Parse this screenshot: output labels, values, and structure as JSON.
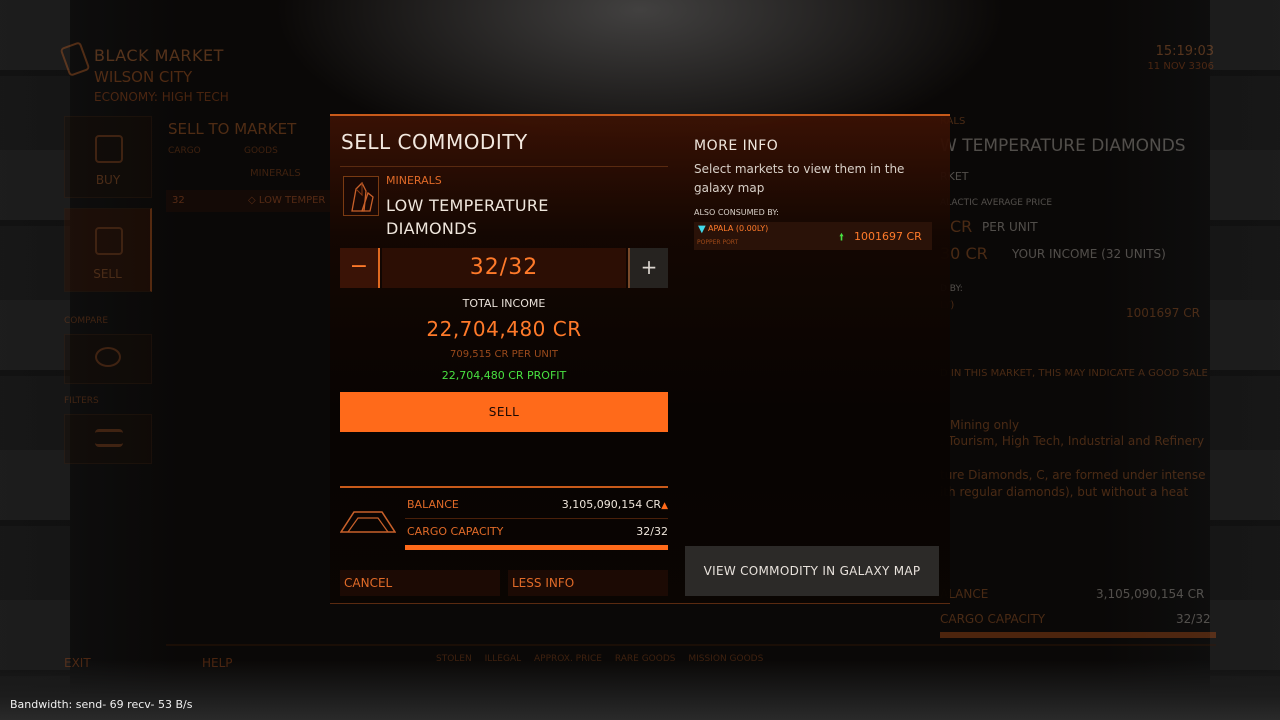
{
  "station": {
    "market_title": "BLACK MARKET",
    "city": "WILSON CITY",
    "economy": "ECONOMY: HIGH TECH",
    "time": "15:19:03",
    "date": "11 NOV 3306"
  },
  "nav": {
    "buy": "BUY",
    "sell": "SELL",
    "compare": "COMPARE",
    "filters": "FILTERS"
  },
  "background_panel": {
    "title": "SELL TO MARKET",
    "columns": [
      "CARGO",
      "GOODS"
    ],
    "category": "MINERALS",
    "row": {
      "cargo": "32",
      "goods": "◇ LOW TEMPER"
    }
  },
  "background_right": {
    "category": "RALS",
    "title": "W TEMPERATURE DIAMONDS",
    "market": "RKET",
    "avg_label": "ALACTIC AVERAGE PRICE",
    "cr": "CR",
    "per_unit": "PER UNIT",
    "income_value": "30 CR",
    "income_label": "YOUR INCOME (32 UNITS)",
    "consumed_label": "D BY:",
    "consumed_sub": "LY)",
    "consumed_price": "1001697 CR",
    "note": "D IN THIS MARKET, THIS MAY INDICATE A GOOD SALE",
    "mining": "Mining only",
    "economies": ": Tourism, High Tech, Industrial and Refinery",
    "desc1": "ture Diamonds, C, are formed under intense",
    "desc2": "ith regular diamonds), but without a heat",
    "balance_label": "ALANCE",
    "balance_value": "3,105,090,154 CR",
    "cargo_label": "CARGO CAPACITY",
    "cargo_value": "32/32"
  },
  "bottom_bar": {
    "exit": "EXIT",
    "help": "HELP",
    "legend": [
      "STOLEN",
      "ILLEGAL",
      "APPROX. PRICE",
      "RARE GOODS",
      "MISSION GOODS"
    ]
  },
  "modal": {
    "title": "SELL COMMODITY",
    "category": "MINERALS",
    "commodity": "LOW TEMPERATURE DIAMONDS",
    "quantity": "32/32",
    "minus": "−",
    "plus": "+",
    "total_income_label": "TOTAL INCOME",
    "total_income": "22,704,480 CR",
    "per_unit": "709,515 CR PER UNIT",
    "profit": "22,704,480 CR PROFIT",
    "sell_label": "SELL",
    "balance_label": "BALANCE",
    "balance_value": "3,105,090,154 CR",
    "cargo_label": "CARGO CAPACITY",
    "cargo_value": "32/32",
    "cargo_fill_fraction": 1.0,
    "cancel_label": "CANCEL",
    "less_info_label": "LESS INFO",
    "more_info": {
      "title": "MORE INFO",
      "description": "Select markets to view them in the galaxy map",
      "also_consumed_label": "ALSO CONSUMED BY:",
      "market_name": "APALA (0.00LY)",
      "market_port": "POPPER PORT",
      "market_price": "1001697 CR",
      "galaxy_map_label": "VIEW COMMODITY IN GALAXY MAP"
    }
  },
  "diagnostics": {
    "bandwidth": "Bandwidth: send- 69 recv- 53 B/s"
  },
  "colors": {
    "accent": "#ff6a1a",
    "profit": "#48e040",
    "text_light": "#efe6dc"
  }
}
